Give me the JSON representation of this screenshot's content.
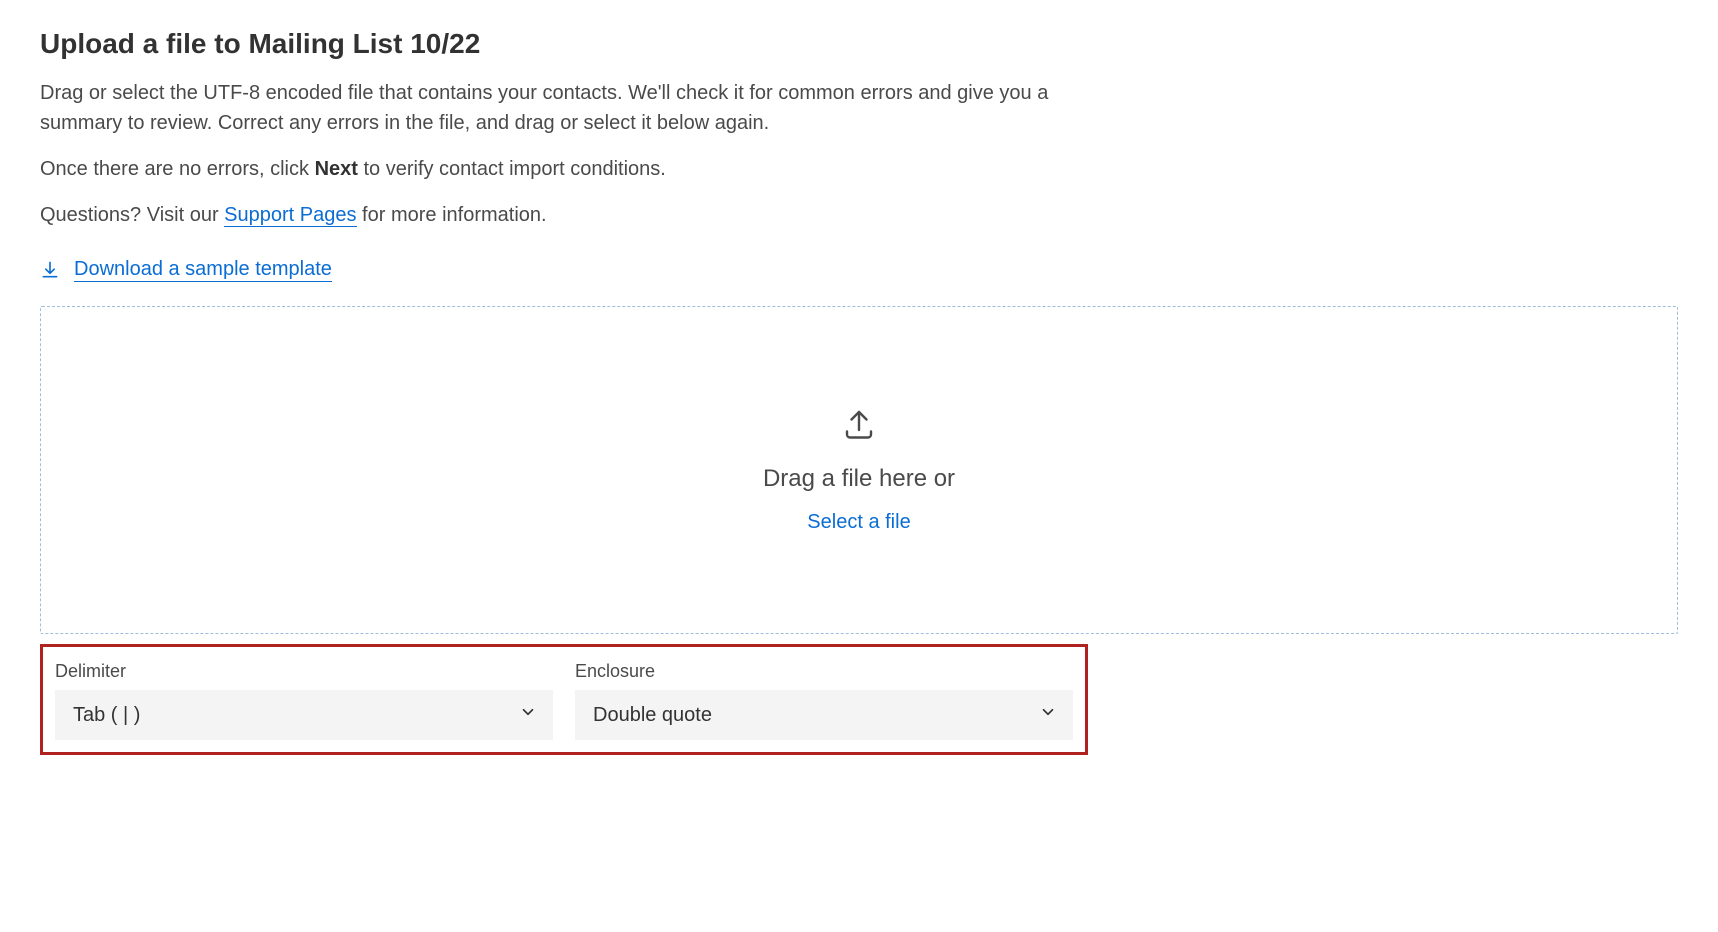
{
  "header": {
    "title": "Upload a file to Mailing List 10/22"
  },
  "description": {
    "para1": "Drag or select the UTF-8 encoded file that contains your contacts. We'll check it for common errors and give you a summary to review. Correct any errors in the file, and drag or select it below again.",
    "para2_pre": "Once there are no errors, click ",
    "para2_bold": "Next",
    "para2_post": " to verify contact import conditions.",
    "para3_pre": "Questions? Visit our ",
    "para3_link": "Support Pages",
    "para3_post": " for more information."
  },
  "download": {
    "label": "Download a sample template"
  },
  "dropzone": {
    "text": "Drag a file here or",
    "link": "Select a file"
  },
  "fields": {
    "delimiter": {
      "label": "Delimiter",
      "value": "Tab ( | )"
    },
    "enclosure": {
      "label": "Enclosure",
      "value": "Double quote"
    }
  }
}
